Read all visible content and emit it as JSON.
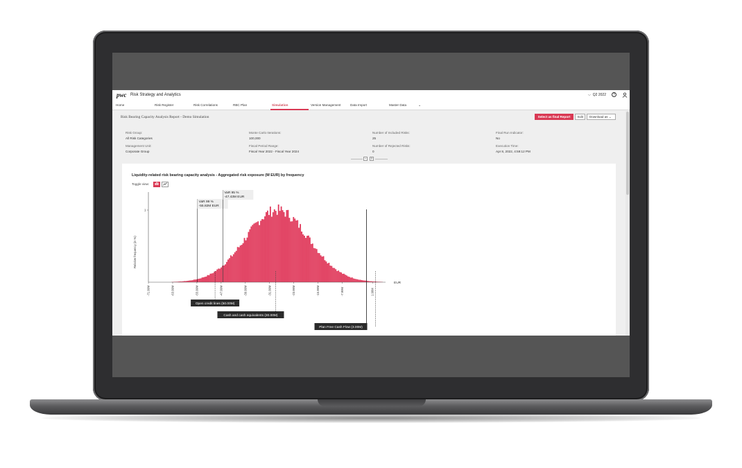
{
  "header": {
    "logo": "pwc",
    "app_title": "Risk Strategy and Analytics",
    "period": "Q2 2022",
    "help_glyph": "?"
  },
  "nav": {
    "items": [
      "Home",
      "Risk Register",
      "Risk Correlations",
      "RBC Plan",
      "Simulation",
      "Version Management",
      "Data Import",
      "Master Data"
    ],
    "active": "Simulation",
    "more_glyph": "⌄"
  },
  "report": {
    "title": "Risk Bearing Capacity Analysis Report - Demo Simulation",
    "select_button": "Select as final Report",
    "edit_button": "Edit",
    "download_button": "Download as"
  },
  "meta": {
    "risk_group_label": "Risk Group:",
    "risk_group_value": "All Risk Categories",
    "monte_carlo_label": "Monte Carlo Iterations:",
    "monte_carlo_value": "100,000",
    "included_label": "Number of Included Risks:",
    "included_value": "25",
    "final_run_label": "Final Run Indicator:",
    "final_run_value": "No",
    "mgmt_unit_label": "Management Unit:",
    "mgmt_unit_value": "Corporate Group",
    "fiscal_label": "Fiscal Period Range:",
    "fiscal_value": "Fiscal Year 2022 - Fiscal Year 2024",
    "rejected_label": "Number of Rejected Risks:",
    "rejected_value": "0",
    "exec_label": "Execution Time:",
    "exec_value": "Apr 8, 2022, 4:59:12 PM"
  },
  "chart_title": "Liquidity-related risk bearing capacity analysis - Aggregated risk exposure (M EUR) by frequency",
  "toggle_label": "Toggle view:",
  "colors": {
    "accent": "#d93954",
    "bar": "#e0385a",
    "annotation_bg": "#2b2b2b"
  },
  "chart_data": {
    "type": "bar",
    "xlabel": "EUR",
    "ylabel": "Relative frequency (in %)",
    "x_ticks": [
      "-71.99M",
      "-63.99M",
      "-55.99M",
      "-47.99M",
      "-39.99M",
      "-31.99M",
      "-23.99M",
      "-15.99M",
      "-7.99M",
      "1.99M"
    ],
    "x_range": [
      -72,
      4
    ],
    "y_ticks": [
      "1"
    ],
    "ylim": [
      0,
      1.25
    ],
    "distribution": {
      "mean": -29.5,
      "std": 10.5,
      "peak": 1.0
    },
    "var_lines": [
      {
        "label": "VaR 99 %",
        "value_label": "-55.82M EUR",
        "x": -55.82
      },
      {
        "label": "VaR 95 %",
        "value_label": "-47.43M EUR",
        "x": -47.43
      }
    ],
    "reference_lines": [
      {
        "label": "Open credit lines (50.00M)",
        "x": -50.0,
        "style": "dashed"
      },
      {
        "label": "Cash and cash equivalents (30.00M)",
        "x": -30.0,
        "style": "dashed"
      },
      {
        "label": "Plan Free Cash Flow (3.00M)",
        "x": 3.0,
        "style": "dashed"
      }
    ],
    "zero_line": 0
  }
}
